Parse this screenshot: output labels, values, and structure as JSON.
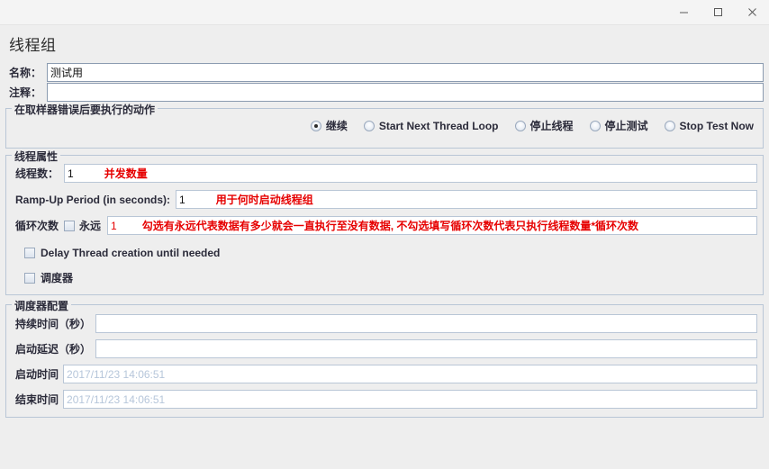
{
  "window": {
    "controls": {
      "minimize": "minimize-icon",
      "maximize": "maximize-icon",
      "close": "close-icon"
    }
  },
  "page": {
    "title": "线程组"
  },
  "name_row": {
    "label": "名称：",
    "value": "测试用"
  },
  "comment_row": {
    "label": "注释：",
    "value": ""
  },
  "on_error": {
    "legend": "在取样器错误后要执行的动作",
    "options": [
      {
        "label": "继续",
        "selected": true
      },
      {
        "label": "Start Next Thread Loop",
        "selected": false
      },
      {
        "label": "停止线程",
        "selected": false
      },
      {
        "label": "停止测试",
        "selected": false
      },
      {
        "label": "Stop Test Now",
        "selected": false
      }
    ]
  },
  "thread_props": {
    "legend": "线程属性",
    "thread_count": {
      "label": "线程数：",
      "value": "1",
      "annotation": "并发数量"
    },
    "ramp_up": {
      "label": "Ramp-Up Period (in seconds):",
      "value": "1",
      "annotation": "用于何时启动线程组"
    },
    "loop_count": {
      "label": "循环次数",
      "forever_label": "永远",
      "forever_checked": false,
      "value": "1",
      "annotation": "勾选有永远代表数据有多少就会一直执行至没有数据, 不勾选填写循环次数代表只执行线程数量*循环次数"
    },
    "delay_creation": {
      "label": "Delay Thread creation until needed",
      "checked": false
    },
    "scheduler_toggle": {
      "label": "调度器",
      "checked": false
    }
  },
  "scheduler": {
    "legend": "调度器配置",
    "duration": {
      "label": "持续时间（秒）",
      "value": ""
    },
    "startup_delay": {
      "label": "启动延迟（秒）",
      "value": ""
    },
    "start_time": {
      "label": "启动时间",
      "value": "2017/11/23 14:06:51"
    },
    "end_time": {
      "label": "结束时间",
      "value": "2017/11/23 14:06:51"
    }
  }
}
